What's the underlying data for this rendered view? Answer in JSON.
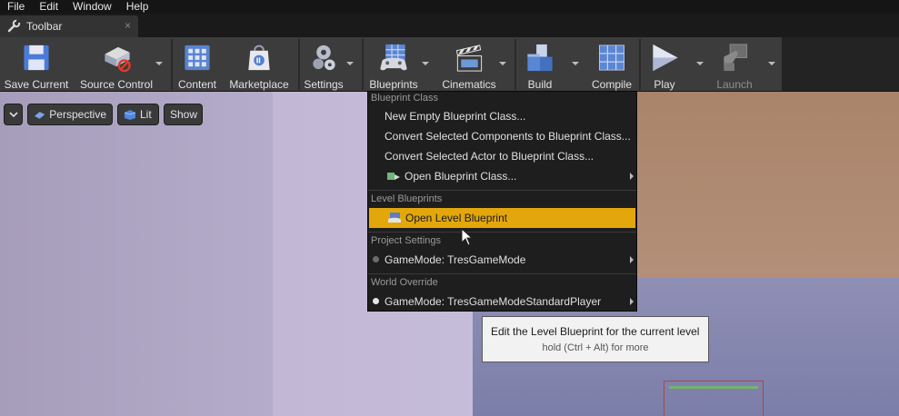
{
  "menubar": {
    "items": [
      "File",
      "Edit",
      "Window",
      "Help"
    ]
  },
  "tab": {
    "title": "Toolbar",
    "close": "×"
  },
  "toolbar": {
    "buttons": [
      {
        "label": "Save Current",
        "icon": "save-icon"
      },
      {
        "label": "Source Control",
        "icon": "source-control-icon"
      },
      {
        "label": "Content",
        "icon": "content-icon"
      },
      {
        "label": "Marketplace",
        "icon": "marketplace-icon"
      },
      {
        "label": "Settings",
        "icon": "settings-icon"
      },
      {
        "label": "Blueprints",
        "icon": "blueprints-icon"
      },
      {
        "label": "Cinematics",
        "icon": "cinematics-icon"
      },
      {
        "label": "Build",
        "icon": "build-icon"
      },
      {
        "label": "Compile",
        "icon": "compile-icon"
      },
      {
        "label": "Play",
        "icon": "play-icon"
      },
      {
        "label": "Launch",
        "icon": "launch-icon",
        "disabled": true
      }
    ]
  },
  "viewport": {
    "view_options_icon": "chevron-down-icon",
    "perspective": "Perspective",
    "lit": "Lit",
    "show": "Show"
  },
  "menu": {
    "sections": [
      {
        "title": "Blueprint Class",
        "items": [
          {
            "label": "New Empty Blueprint Class..."
          },
          {
            "label": "Convert Selected Components to Blueprint Class..."
          },
          {
            "label": "Convert Selected Actor to Blueprint Class..."
          },
          {
            "label": "Open Blueprint Class...",
            "icon": "blueprint-class-icon",
            "submenu": true
          }
        ]
      },
      {
        "title": "Level Blueprints",
        "items": [
          {
            "label": "Open Level Blueprint",
            "icon": "level-blueprint-icon",
            "highlighted": true
          }
        ]
      },
      {
        "title": "Project Settings",
        "items": [
          {
            "label": "GameMode: TresGameMode",
            "bullet": "gray",
            "submenu": true
          }
        ]
      },
      {
        "title": "World Override",
        "items": [
          {
            "label": "GameMode: TresGameModeStandardPlayer",
            "bullet": "white",
            "submenu": true
          }
        ]
      }
    ]
  },
  "tooltip": {
    "title": "Edit the Level Blueprint for the current level",
    "hint": "hold (Ctrl + Alt) for more"
  },
  "colors": {
    "highlight": "#e3a70c",
    "menu_bg": "#1e1e1e",
    "toolbar_bg": "#3c3c3c"
  }
}
